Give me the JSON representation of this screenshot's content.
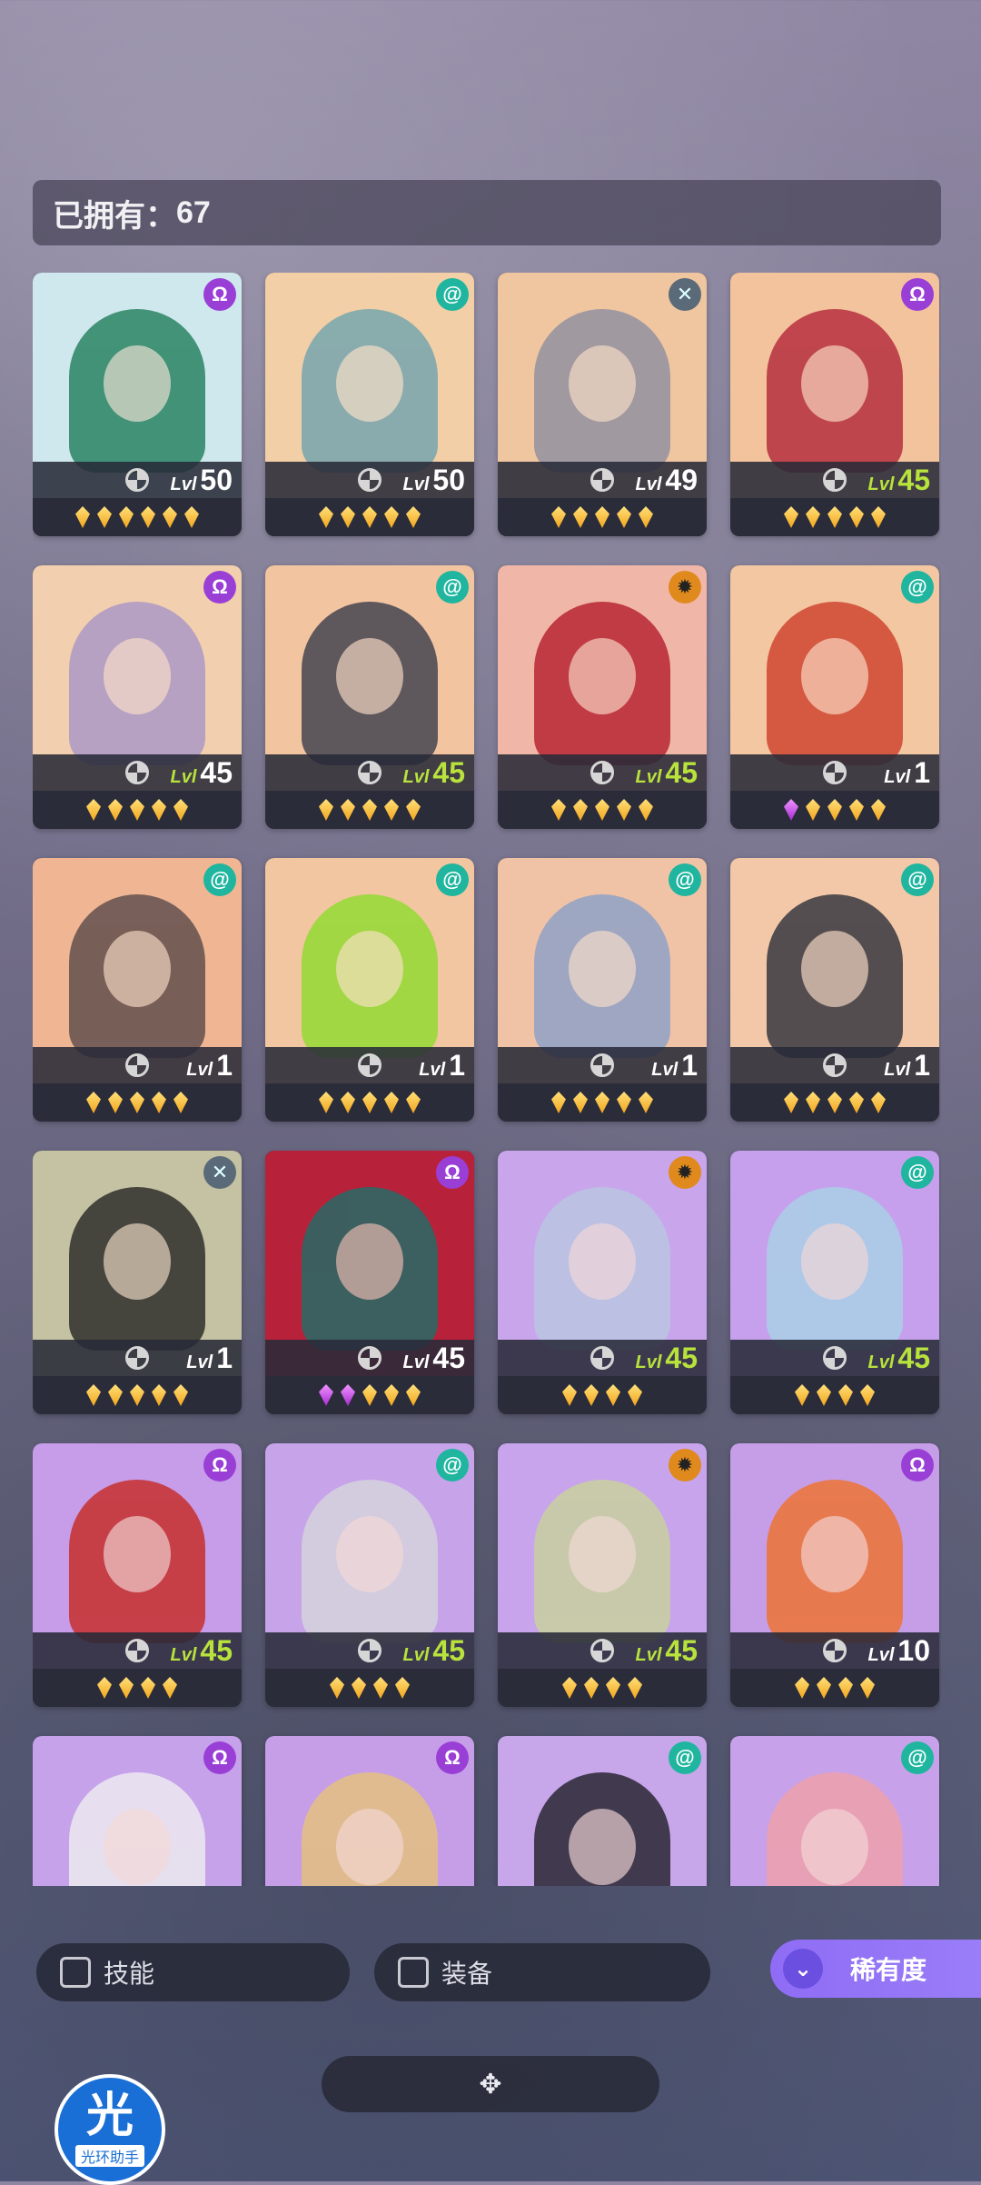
{
  "header": {
    "owned_label": "已拥有：",
    "owned_count": "67"
  },
  "level_prefix": "Lvl",
  "cards": [
    {
      "level": "50",
      "level_color": "white",
      "faction": "purple",
      "faction_icon": "omega-icon",
      "gems": [
        "gold",
        "gold",
        "gold",
        "gold",
        "gold",
        "gold"
      ],
      "bg": "#cfe8ee",
      "fig": "#1e7d5a"
    },
    {
      "level": "50",
      "level_color": "white",
      "faction": "green",
      "faction_icon": "spiral-icon",
      "gems": [
        "gold",
        "gold",
        "gold",
        "gold",
        "gold"
      ],
      "bg": "#f2cfa6",
      "fig": "#6fa3b0"
    },
    {
      "level": "49",
      "level_color": "white",
      "faction": "grey",
      "faction_icon": "cross-icon",
      "gems": [
        "gold",
        "gold",
        "gold",
        "gold",
        "gold"
      ],
      "bg": "#f0c6a0",
      "fig": "#8e8ea0"
    },
    {
      "level": "45",
      "level_color": "green",
      "faction": "purple",
      "faction_icon": "omega-icon",
      "gems": [
        "gold",
        "gold",
        "gold",
        "gold",
        "gold"
      ],
      "bg": "#f2c39c",
      "fig": "#b3263a"
    },
    {
      "level": "45",
      "level_color": "mixed",
      "faction": "purple",
      "faction_icon": "omega-icon",
      "gems": [
        "gold",
        "gold",
        "gold",
        "gold",
        "gold"
      ],
      "bg": "#f2cfae",
      "fig": "#a996c7"
    },
    {
      "level": "45",
      "level_color": "green",
      "faction": "green",
      "faction_icon": "spiral-icon",
      "gems": [
        "gold",
        "gold",
        "gold",
        "gold",
        "gold"
      ],
      "bg": "#f2c4a0",
      "fig": "#3a3d4c"
    },
    {
      "level": "45",
      "level_color": "green",
      "faction": "orange",
      "faction_icon": "sun-icon",
      "gems": [
        "gold",
        "gold",
        "gold",
        "gold",
        "gold"
      ],
      "bg": "#f0b7a8",
      "fig": "#b51d2a"
    },
    {
      "level": "1",
      "level_color": "white",
      "faction": "green",
      "faction_icon": "spiral-icon",
      "gems": [
        "purple",
        "gold",
        "gold",
        "gold",
        "gold"
      ],
      "bg": "#f2c7a2",
      "fig": "#cf3d2a"
    },
    {
      "level": "1",
      "level_color": "white",
      "faction": "green",
      "faction_icon": "spiral-icon",
      "gems": [
        "gold",
        "gold",
        "gold",
        "gold",
        "gold"
      ],
      "bg": "#f0b694",
      "fig": "#5a4a4a"
    },
    {
      "level": "1",
      "level_color": "white",
      "faction": "green",
      "faction_icon": "spiral-icon",
      "gems": [
        "gold",
        "gold",
        "gold",
        "gold",
        "gold"
      ],
      "bg": "#f2c6a0",
      "fig": "#8cdc2c"
    },
    {
      "level": "1",
      "level_color": "white",
      "faction": "green",
      "faction_icon": "spiral-icon",
      "gems": [
        "gold",
        "gold",
        "gold",
        "gold",
        "gold"
      ],
      "bg": "#f0c2a6",
      "fig": "#8aa0c8"
    },
    {
      "level": "1",
      "level_color": "white",
      "faction": "green",
      "faction_icon": "spiral-icon",
      "gems": [
        "gold",
        "gold",
        "gold",
        "gold",
        "gold"
      ],
      "bg": "#f2c8a8",
      "fig": "#2d2f3a"
    },
    {
      "level": "1",
      "level_color": "white",
      "faction": "grey",
      "faction_icon": "cross-icon",
      "gems": [
        "gold",
        "gold",
        "gold",
        "gold",
        "gold"
      ],
      "bg": "#c4c2a2",
      "fig": "#262626"
    },
    {
      "level": "45",
      "level_color": "white",
      "faction": "purple",
      "faction_icon": "omega-icon",
      "gems": [
        "purple",
        "purple",
        "gold",
        "gold",
        "gold"
      ],
      "bg": "#b8213a",
      "fig": "#1e6f6a"
    },
    {
      "level": "45",
      "level_color": "green",
      "faction": "orange",
      "faction_icon": "sun-icon",
      "gems": [
        "gold",
        "gold",
        "gold",
        "gold"
      ],
      "bg": "#c9a5ec",
      "fig": "#b9c7e2"
    },
    {
      "level": "45",
      "level_color": "green",
      "faction": "green",
      "faction_icon": "spiral-icon",
      "gems": [
        "gold",
        "gold",
        "gold",
        "gold"
      ],
      "bg": "#c6a0ec",
      "fig": "#a9d2e6"
    },
    {
      "level": "45",
      "level_color": "green",
      "faction": "purple",
      "faction_icon": "omega-icon",
      "gems": [
        "gold",
        "gold",
        "gold",
        "gold"
      ],
      "bg": "#c79ce8",
      "fig": "#c62820"
    },
    {
      "level": "45",
      "level_color": "green",
      "faction": "green",
      "faction_icon": "spiral-icon",
      "gems": [
        "gold",
        "gold",
        "gold",
        "gold"
      ],
      "bg": "#c7a3ea",
      "fig": "#d6d6dc"
    },
    {
      "level": "45",
      "level_color": "green",
      "faction": "orange",
      "faction_icon": "sun-icon",
      "gems": [
        "gold",
        "gold",
        "gold",
        "gold"
      ],
      "bg": "#c7a4ec",
      "fig": "#c9d39a"
    },
    {
      "level": "10",
      "level_color": "white",
      "faction": "purple",
      "faction_icon": "omega-icon",
      "gems": [
        "gold",
        "gold",
        "gold",
        "gold"
      ],
      "bg": "#c69ee8",
      "fig": "#f07028"
    },
    {
      "level": "",
      "level_color": "white",
      "faction": "purple",
      "faction_icon": "omega-icon",
      "gems": [],
      "bg": "#c6a2ea",
      "fig": "#efeff0"
    },
    {
      "level": "",
      "level_color": "white",
      "faction": "purple",
      "faction_icon": "omega-icon",
      "gems": [],
      "bg": "#c69ee8",
      "fig": "#e7c27a"
    },
    {
      "level": "",
      "level_color": "white",
      "faction": "green",
      "faction_icon": "spiral-icon",
      "gems": [],
      "bg": "#c7a6ea",
      "fig": "#202028"
    },
    {
      "level": "",
      "level_color": "white",
      "faction": "green",
      "faction_icon": "spiral-icon",
      "gems": [],
      "bg": "#c7a2ea",
      "fig": "#f0a0a8"
    }
  ],
  "filters": {
    "skill_label": "技能",
    "equip_label": "装备",
    "rarity_label": "稀有度"
  },
  "expand_label": "✥",
  "logo": {
    "big": "光",
    "small": "光环助手"
  }
}
